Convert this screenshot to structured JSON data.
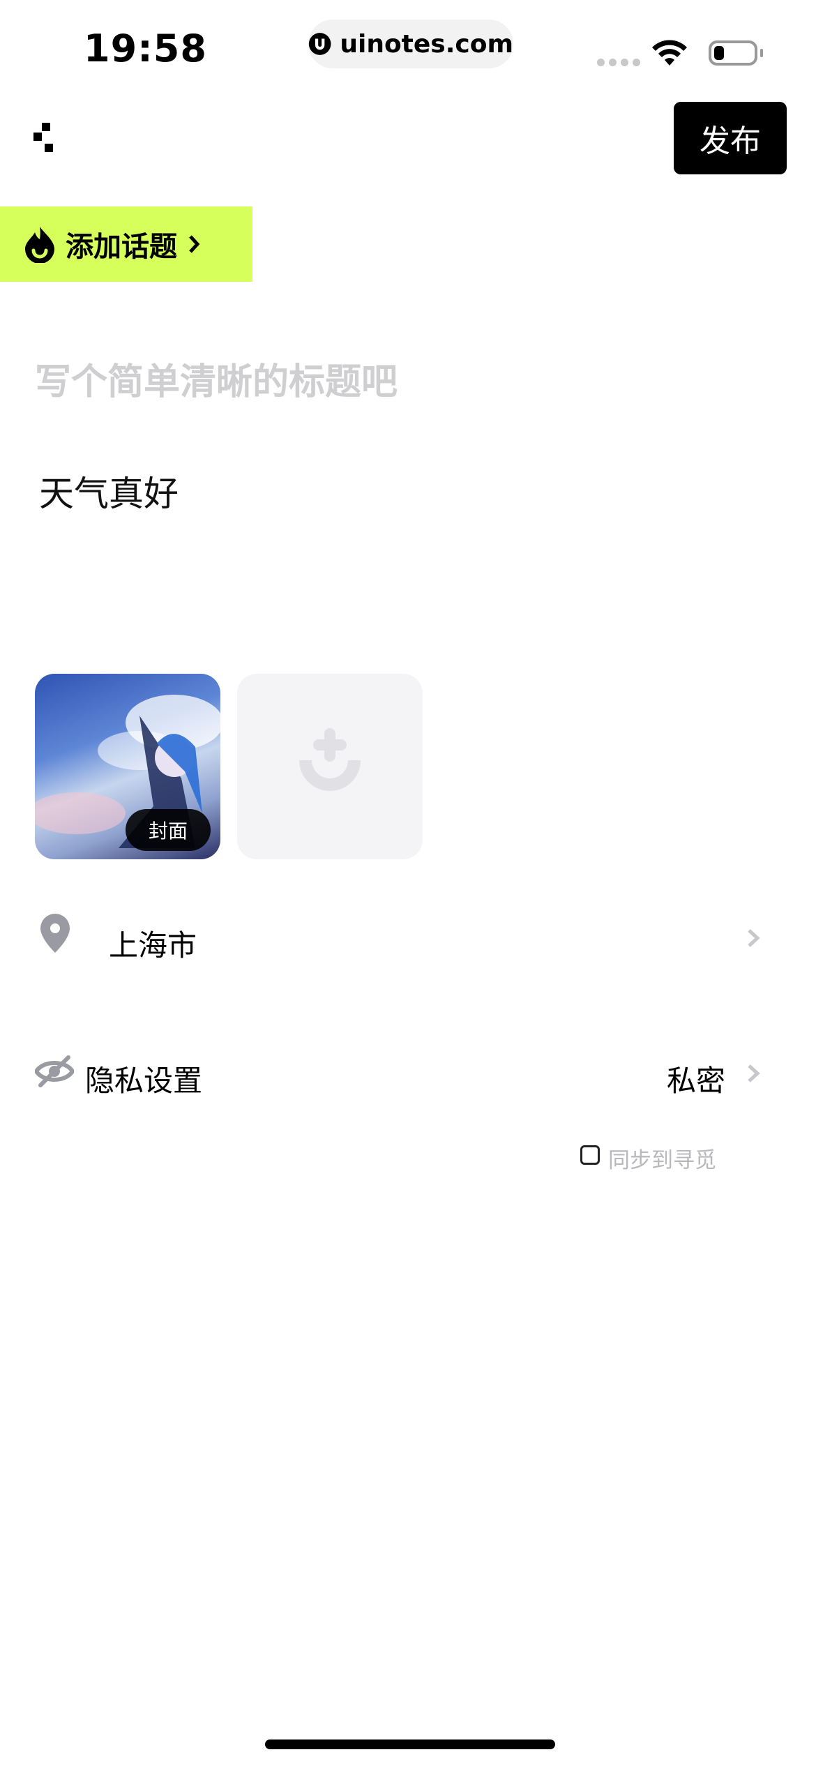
{
  "status_bar": {
    "time": "19:58",
    "url": "uinotes.com"
  },
  "header": {
    "menu_icon": "pixel-dots-icon",
    "publish_label": "发布"
  },
  "topic": {
    "icon": "flame-icon",
    "label": "添加话题"
  },
  "editor": {
    "title_placeholder": "写个简单清晰的标题吧",
    "title_value": "",
    "body_text": "天气真好"
  },
  "images": {
    "cover_label": "封面",
    "add_icon": "add-image-icon"
  },
  "location": {
    "icon": "location-pin-icon",
    "value": "上海市"
  },
  "privacy": {
    "icon": "eye-hidden-icon",
    "label": "隐私设置",
    "value": "私密"
  },
  "sync": {
    "checked": false,
    "label": "同步到寻觅"
  },
  "colors": {
    "accent": "#d6ff5c",
    "primary": "#000000",
    "placeholder": "#cfcfd2",
    "muted": "#b8b8bd"
  }
}
